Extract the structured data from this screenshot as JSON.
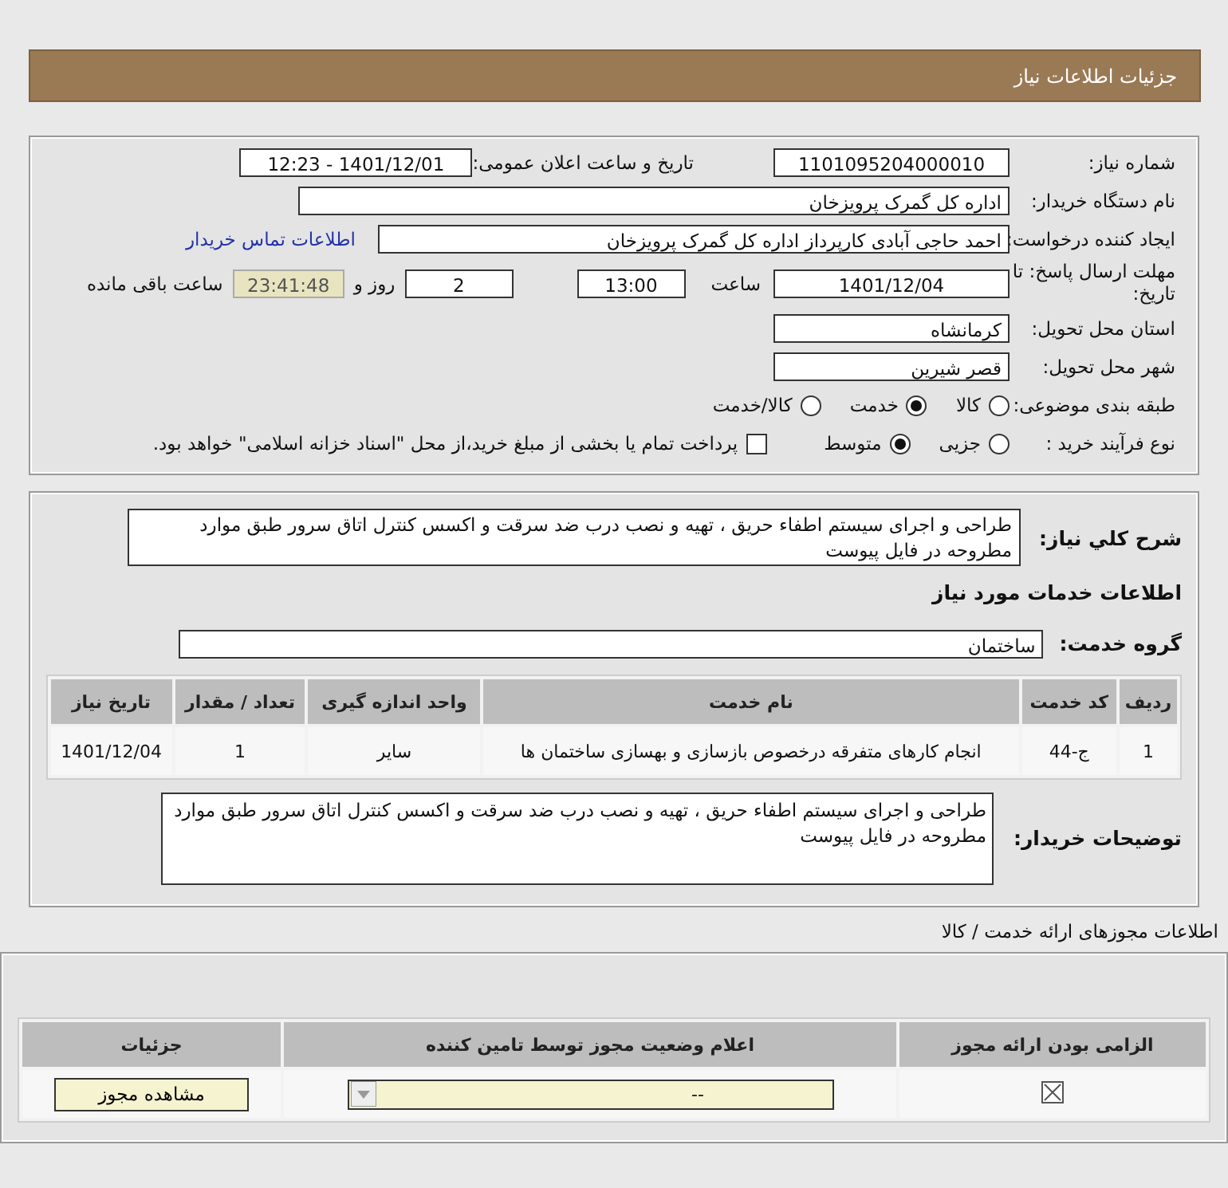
{
  "header": {
    "title": "جزئیات اطلاعات نیاز"
  },
  "details": {
    "need_number": {
      "label": "شماره نیاز:",
      "value": "1101095204000010"
    },
    "announce": {
      "label": "تاریخ و ساعت اعلان عمومی:",
      "value": "1401/12/01 - 12:23"
    },
    "buyer_org": {
      "label": "نام دستگاه خریدار:",
      "value": "اداره کل گمرک پرویزخان"
    },
    "requester": {
      "label": "ایجاد کننده درخواست:",
      "value": "احمد حاجی آبادی کارپرداز اداره کل گمرک پرویزخان",
      "link": "اطلاعات تماس خریدار"
    },
    "deadline": {
      "label": "مهلت ارسال پاسخ: تا تاریخ:",
      "date": "1401/12/04",
      "time_label": "ساعت",
      "time": "13:00",
      "days": "2",
      "days_label": "روز و",
      "remaining": "23:41:48",
      "remaining_label": "ساعت باقی مانده"
    },
    "province": {
      "label": "استان محل تحویل:",
      "value": "کرمانشاه"
    },
    "city": {
      "label": "شهر محل تحویل:",
      "value": "قصر شیرین"
    },
    "category": {
      "label": "طبقه بندی موضوعی:",
      "options": [
        {
          "label": "کالا",
          "selected": false
        },
        {
          "label": "خدمت",
          "selected": true
        },
        {
          "label": "کالا/خدمت",
          "selected": false
        }
      ]
    },
    "purchase_type": {
      "label": "نوع فرآیند خرید :",
      "options": [
        {
          "label": "جزیی",
          "selected": false
        },
        {
          "label": "متوسط",
          "selected": true
        }
      ],
      "payment": {
        "checked": false,
        "label": "پرداخت تمام یا بخشی از مبلغ خرید،از محل \"اسناد خزانه اسلامی\" خواهد بود."
      }
    }
  },
  "summary": {
    "label": "شرح کلي نياز:",
    "value": "طراحی و اجرای سیستم اطفاء حریق ، تهیه و نصب درب ضد سرقت و اکسس کنترل اتاق سرور طبق موارد مطروحه در فایل پیوست"
  },
  "services_title": "اطلاعات خدمات مورد نیاز",
  "service_group": {
    "label": "گروه خدمت:",
    "value": "ساختمان"
  },
  "table": {
    "columns": [
      "ردیف",
      "کد خدمت",
      "نام خدمت",
      "واحد اندازه گیری",
      "تعداد / مقدار",
      "تاریخ نیاز"
    ],
    "rows": [
      [
        "1",
        "ج-44",
        "انجام کارهای متفرقه درخصوص بازسازی و بهسازی ساختمان ها",
        "سایر",
        "1",
        "1401/12/04"
      ]
    ]
  },
  "buyer_notes": {
    "label": "توضیحات خریدار:",
    "value": "طراحی و اجرای سیستم اطفاء حریق ، تهیه و نصب درب ضد سرقت و اکسس کنترل اتاق سرور طبق موارد مطروحه در فایل پیوست"
  },
  "licenses": {
    "title": "اطلاعات مجوزهای ارائه خدمت / کالا",
    "columns": [
      "الزامی بودن ارائه مجوز",
      "اعلام وضعیت مجوز توسط تامین کننده",
      "جزئیات"
    ],
    "rows": [
      {
        "status": "--",
        "button": "مشاهده مجوز"
      }
    ]
  }
}
